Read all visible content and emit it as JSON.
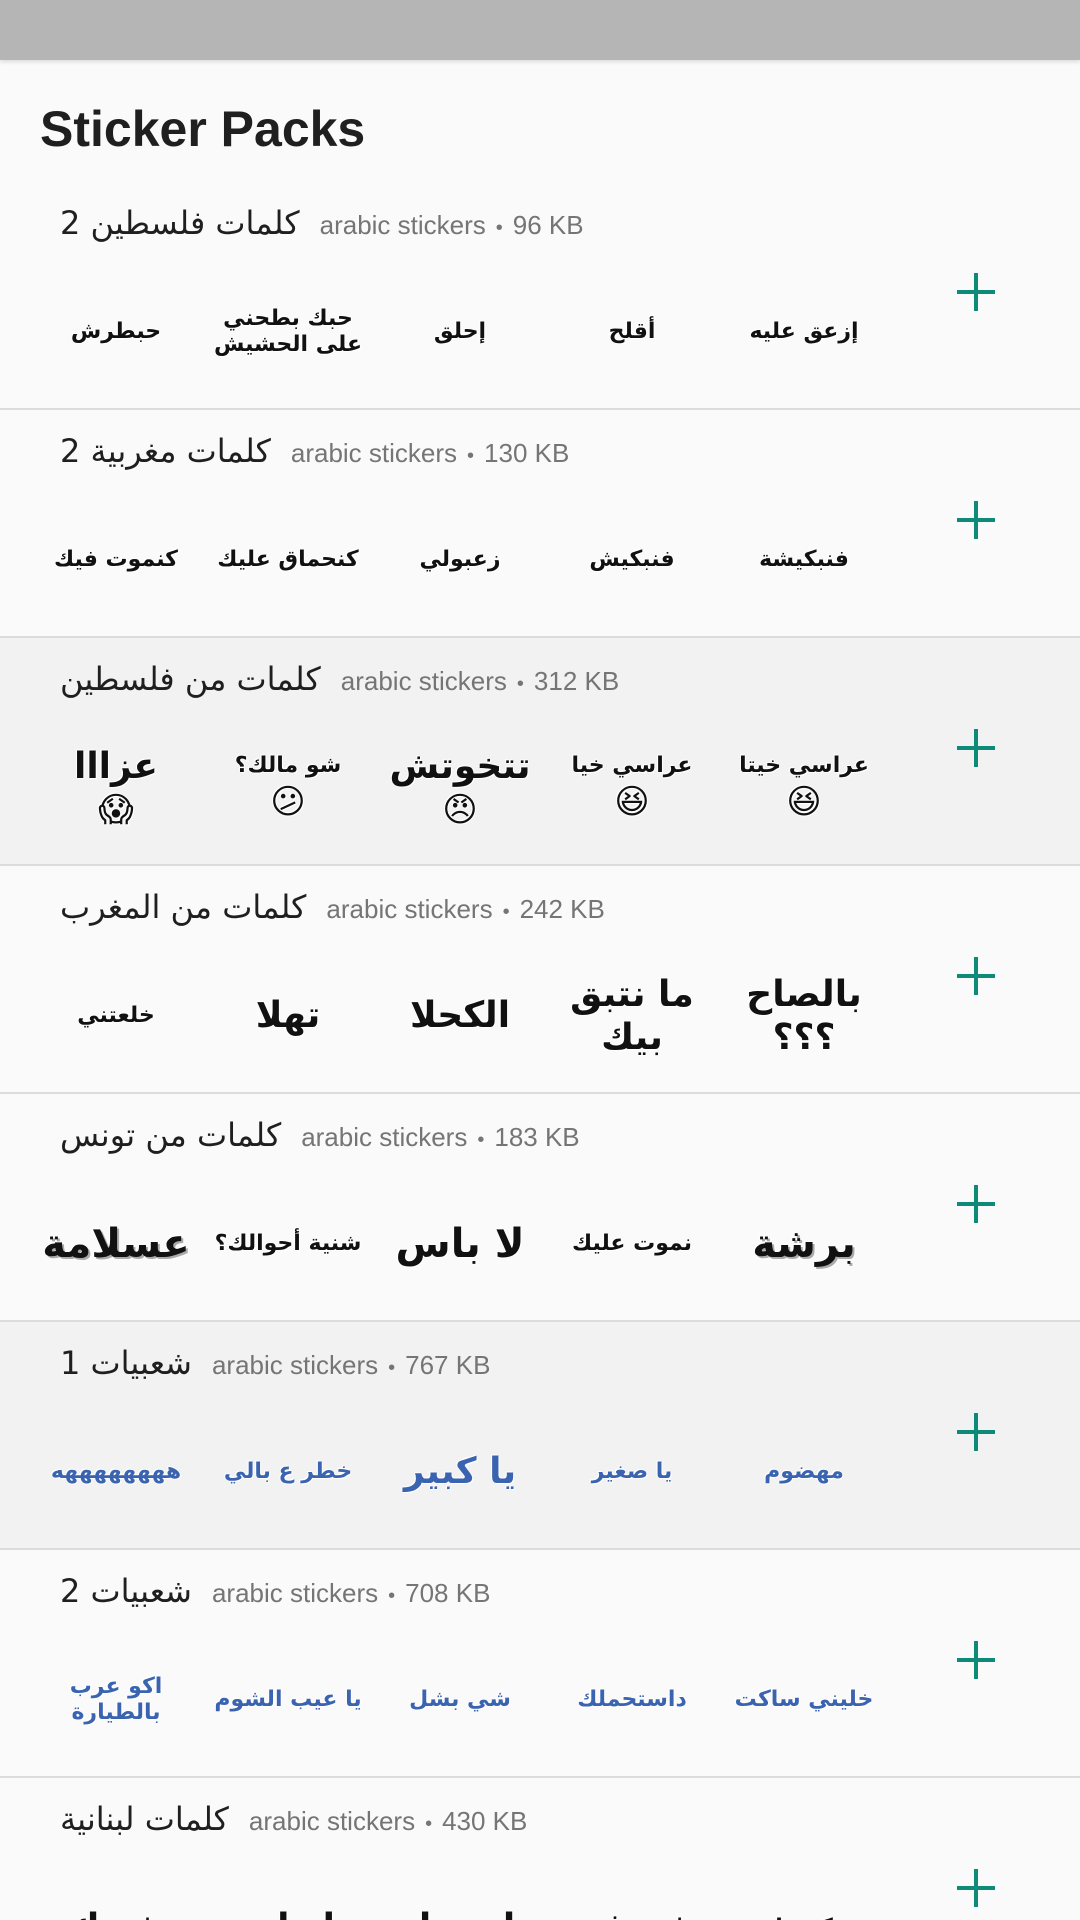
{
  "header": {
    "title": "Sticker Packs"
  },
  "meta_separator": "•",
  "packs": [
    {
      "name": "كلمات فلسطين 2",
      "publisher": "arabic stickers",
      "size": "96 KB",
      "stickers": [
        "حبطرش",
        "حبك بطحني على الحشيش",
        "إحلق",
        "أقلح",
        "إزعق عليه"
      ]
    },
    {
      "name": "كلمات مغربية 2",
      "publisher": "arabic stickers",
      "size": "130 KB",
      "stickers": [
        "كنموت فيك",
        "كنحماق عليك",
        "زعبولي",
        "فنبكيش",
        "فنبكيشة"
      ]
    },
    {
      "name": "كلمات من فلسطين",
      "publisher": "arabic stickers",
      "size": "312 KB",
      "stickers": [
        "عزااا",
        "شو مالك؟",
        "تتخوتش",
        "عراسي خيا",
        "عراسي خيتا"
      ]
    },
    {
      "name": "كلمات من المغرب",
      "publisher": "arabic stickers",
      "size": "242 KB",
      "stickers": [
        "خلعتني",
        "تهلا",
        "الكحلا",
        "ما نتبق بيك",
        "بالصاح ؟؟؟"
      ]
    },
    {
      "name": "كلمات من تونس",
      "publisher": "arabic stickers",
      "size": "183 KB",
      "stickers": [
        "عسلامة",
        "شنية أحوالك؟",
        "لا باس",
        "نموت عليك",
        "برشة"
      ]
    },
    {
      "name": "شعبيات 1",
      "publisher": "arabic stickers",
      "size": "767 KB",
      "stickers": [
        "ههههههههه",
        "خطر ع بالي",
        "يا كبير",
        "يا صغير",
        "مهضوم"
      ]
    },
    {
      "name": "شعبيات 2",
      "publisher": "arabic stickers",
      "size": "708 KB",
      "stickers": [
        "اكو عرب بالطيارة",
        "يا عيب الشوم",
        "شي بشل",
        "داستحملك",
        "خليني ساكت"
      ]
    },
    {
      "name": "كلمات لبنانية",
      "publisher": "arabic stickers",
      "size": "430 KB",
      "stickers": [
        "شبيك",
        "ادباب",
        "ما تعملي",
        "شو في",
        "كهربا"
      ]
    }
  ]
}
